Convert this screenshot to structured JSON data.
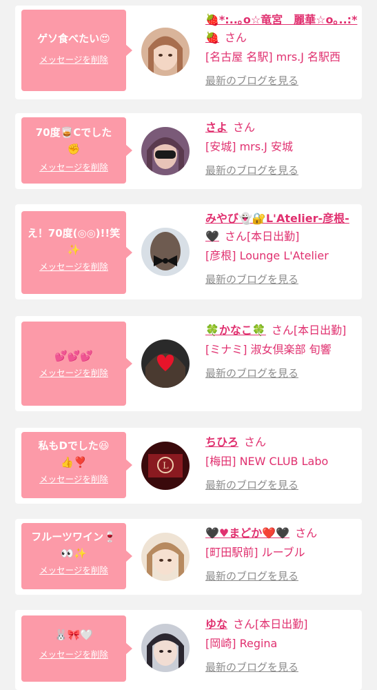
{
  "delete_label": "メッセージを削除",
  "blog_label": "最新のブログを見る",
  "honorific": "さん",
  "colors": {
    "accent": "#e0306f",
    "bubble": "#fc9aa8",
    "link_gray": "#8c8c8c",
    "background": "#f2f2f2"
  },
  "items": [
    {
      "message": "ゲソ食べたい😍",
      "name": "🍓*:..｡o☆竜宮　麗華☆o｡..:*🍓",
      "status": "",
      "shop": "[名古屋 名駅] mrs.J 名駅西",
      "avatar_icon": "woman-portrait-avatar"
    },
    {
      "message": "70度🥃Cでした\n✊",
      "name": "さよ",
      "status": "",
      "shop": "[安城] mrs.J 安城",
      "avatar_icon": "woman-portrait-avatar"
    },
    {
      "message": "え！70度(◎◎)!!笑\n✨",
      "name": "みやび👻🔐L'Atelier-彦根-🖤",
      "status": "[本日出勤]",
      "shop": "[彦根] Lounge L'Atelier",
      "avatar_icon": "hair-bow-avatar"
    },
    {
      "message": "💕💕💕",
      "name": "🍀かなこ🍀",
      "status": "[本日出勤]",
      "shop": "[ミナミ] 淑女倶楽部 旬響",
      "avatar_icon": "heart-face-avatar"
    },
    {
      "message": "私もDでした😆\n👍❣️",
      "name": "ちひろ",
      "status": "",
      "shop": "[梅田] NEW CLUB Labo",
      "avatar_icon": "club-logo-avatar"
    },
    {
      "message": "フルーツワイン🍷\n👀✨",
      "name": "🖤♥まどか❤️🖤",
      "status": "",
      "shop": "[町田駅前] ルーブル",
      "avatar_icon": "woman-portrait-avatar"
    },
    {
      "message": "🐰🎀🤍",
      "name": "ゆな",
      "status": "[本日出勤]",
      "shop": "[岡崎] Regina",
      "avatar_icon": "woman-portrait-avatar"
    }
  ]
}
